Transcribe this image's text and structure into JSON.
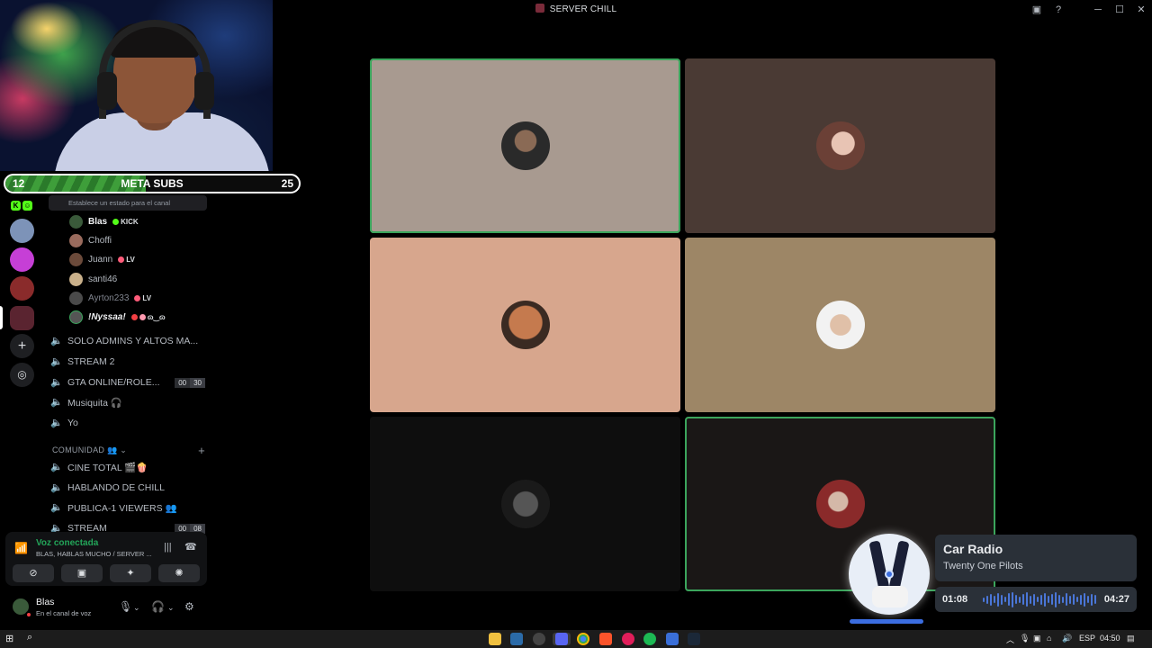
{
  "window": {
    "title": "SERVER CHILL"
  },
  "overlay": {
    "meta_subs": {
      "current": "12",
      "label": "META SUBS",
      "goal": "25",
      "progress": 0.48
    }
  },
  "sidebar": {
    "status_hint": "Establece un estado para el canal",
    "members": [
      {
        "name": "Blas",
        "tag": "KICK",
        "tag_color": "#53fc18",
        "avatar_color": "#3a5a3a",
        "bold": true
      },
      {
        "name": "Choffi",
        "tag": "",
        "tag_color": "",
        "avatar_color": "#9a6b5d",
        "bold": false
      },
      {
        "name": "Juann",
        "tag": "LV",
        "tag_color": "#ff5c7a",
        "avatar_color": "#6b4a3a",
        "bold": false
      },
      {
        "name": "santi46",
        "tag": "",
        "tag_color": "",
        "avatar_color": "#c9b08a",
        "bold": false
      },
      {
        "name": "Ayrton233",
        "tag": "LV",
        "tag_color": "#ff5c7a",
        "avatar_color": "#4a4a4a",
        "bold": false
      },
      {
        "name": "!Nyssaa!",
        "tag": "ɷ‿ɷ",
        "tag_color": "#ff9ab0",
        "avatar_color": "#555555",
        "bold": true
      }
    ],
    "voice_channels": [
      {
        "name": "SOLO ADMINS Y ALTOS MA...",
        "counts": []
      },
      {
        "name": "STREAM 2",
        "counts": []
      },
      {
        "name": "GTA ONLINE/ROLE...",
        "counts": [
          "00",
          "30"
        ]
      },
      {
        "name": "Musiquita 🎧",
        "counts": []
      },
      {
        "name": "Yo",
        "counts": []
      }
    ],
    "category": {
      "label": "COMUNIDAD"
    },
    "community_channels": [
      {
        "name": "CINE TOTAL 🎬🍿",
        "counts": []
      },
      {
        "name": "HABLANDO DE CHILL",
        "counts": []
      },
      {
        "name": "PUBLICA-1 VIEWERS 👥",
        "counts": []
      },
      {
        "name": "STREAM",
        "counts": [
          "00",
          "08"
        ]
      }
    ]
  },
  "voice_panel": {
    "status": "Voz conectada",
    "channel": "BLAS, HABLAS MUCHO / SERVER ..."
  },
  "user": {
    "name": "Blas",
    "status": "En el canal de voz"
  },
  "now_playing": {
    "title": "Car Radio",
    "artist": "Twenty One Pilots",
    "elapsed": "01:08",
    "duration": "04:27",
    "progress": 0.25
  },
  "taskbar": {
    "lang": "ESP",
    "time": "04:50"
  },
  "colors": {
    "speaking_outline": "#3ba55c",
    "voice_connected": "#23a559",
    "accent_blue": "#3b6de0"
  }
}
